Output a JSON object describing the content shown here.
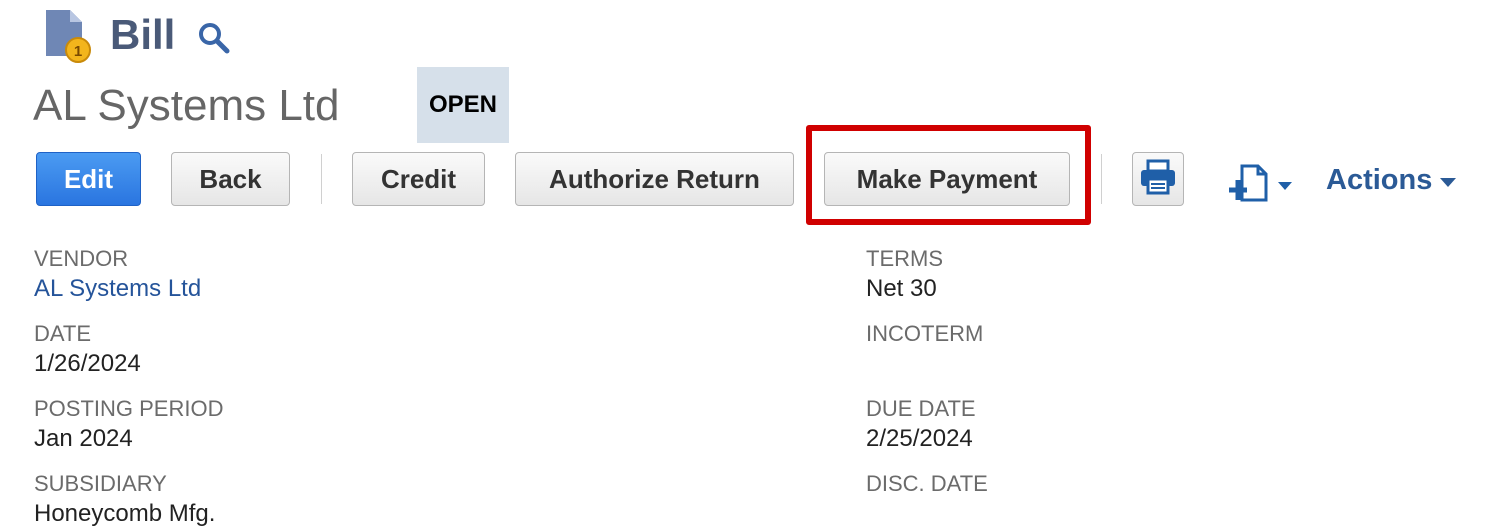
{
  "header": {
    "record_type": "Bill",
    "icon": "bill-document-icon",
    "search_icon": "search-icon"
  },
  "record": {
    "title": "AL Systems Ltd",
    "status": "OPEN"
  },
  "toolbar": {
    "edit_label": "Edit",
    "back_label": "Back",
    "credit_label": "Credit",
    "authorize_return_label": "Authorize Return",
    "make_payment_label": "Make Payment",
    "print_icon": "print-icon",
    "new_document_icon": "new-document-icon",
    "actions_label": "Actions"
  },
  "fields": {
    "vendor": {
      "label": "VENDOR",
      "value": "AL Systems Ltd"
    },
    "date": {
      "label": "DATE",
      "value": "1/26/2024"
    },
    "posting_period": {
      "label": "POSTING PERIOD",
      "value": "Jan 2024"
    },
    "subsidiary": {
      "label": "SUBSIDIARY",
      "value": "Honeycomb Mfg."
    },
    "terms": {
      "label": "TERMS",
      "value": "Net 30"
    },
    "incoterm": {
      "label": "INCOTERM",
      "value": ""
    },
    "due_date": {
      "label": "DUE DATE",
      "value": "2/25/2024"
    },
    "disc_date": {
      "label": "DISC. DATE",
      "value": ""
    }
  },
  "colors": {
    "primary_button": "#2a75e0",
    "link": "#25549a",
    "highlight": "#d00000",
    "status_badge_bg": "#d6e0ea"
  }
}
